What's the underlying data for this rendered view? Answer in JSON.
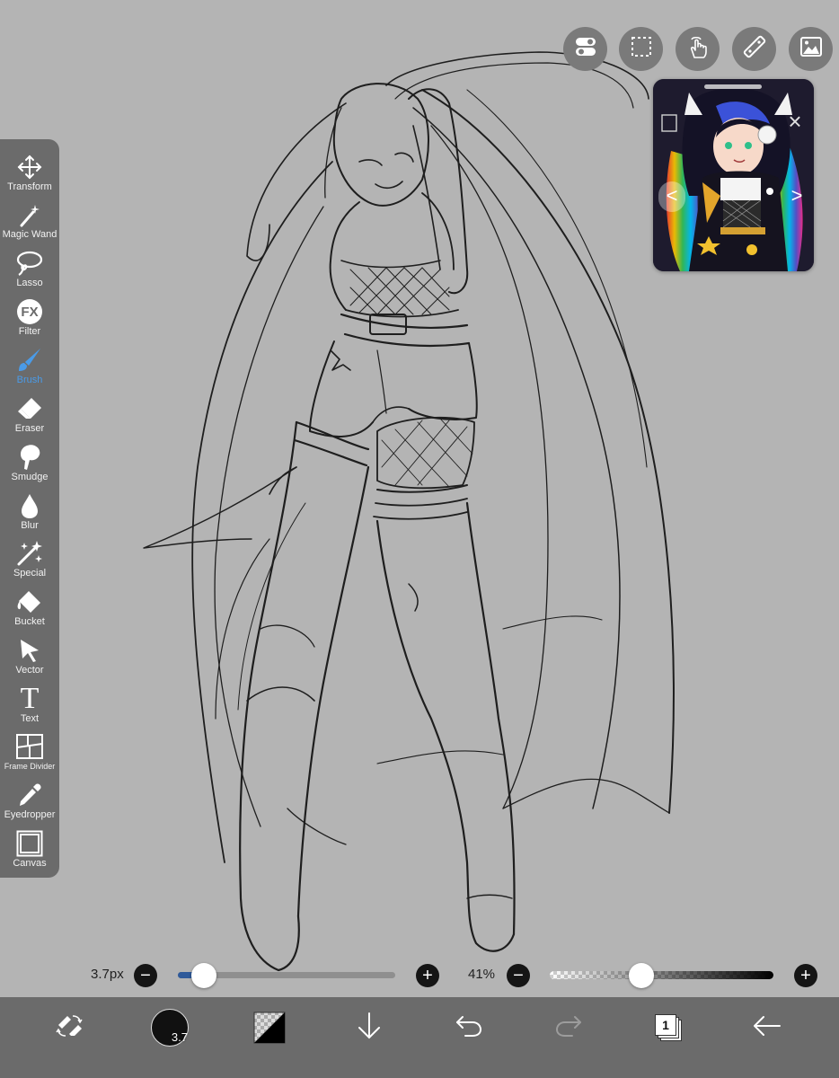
{
  "tools": [
    {
      "label": "Transform",
      "icon": "transform-icon",
      "active": false
    },
    {
      "label": "Magic Wand",
      "icon": "magic-wand-icon",
      "active": false
    },
    {
      "label": "Lasso",
      "icon": "lasso-icon",
      "active": false
    },
    {
      "label": "Filter",
      "icon": "fx-icon",
      "active": false
    },
    {
      "label": "Brush",
      "icon": "brush-icon",
      "active": true
    },
    {
      "label": "Eraser",
      "icon": "eraser-icon",
      "active": false
    },
    {
      "label": "Smudge",
      "icon": "smudge-icon",
      "active": false
    },
    {
      "label": "Blur",
      "icon": "droplet-icon",
      "active": false
    },
    {
      "label": "Special",
      "icon": "sparkle-icon",
      "active": false
    },
    {
      "label": "Bucket",
      "icon": "bucket-icon",
      "active": false
    },
    {
      "label": "Vector",
      "icon": "vector-arrow-icon",
      "active": false
    },
    {
      "label": "Text",
      "icon": "text-icon",
      "active": false
    },
    {
      "label": "Frame Divider",
      "icon": "frame-divider-icon",
      "active": false
    },
    {
      "label": "Eyedropper",
      "icon": "eyedropper-icon",
      "active": false
    },
    {
      "label": "Canvas",
      "icon": "canvas-icon",
      "active": false
    }
  ],
  "filter_icon_text": "FX",
  "text_icon_glyph": "T",
  "top_buttons": [
    "toggle-icon",
    "selection-icon",
    "touch-icon",
    "ruler-icon",
    "image-icon"
  ],
  "reference_window": {
    "nav_prev": "<",
    "nav_next": ">",
    "close": "×"
  },
  "brush_size": {
    "label": "3.7px",
    "minus": "−",
    "plus": "+",
    "level": 0.12
  },
  "opacity": {
    "label": "41%",
    "minus": "−",
    "plus": "+",
    "level": 0.41
  },
  "bottom_bar": {
    "brush_badge": "3.7",
    "layer_count": "1",
    "items": [
      "quick-tools-icon",
      "brush-size-icon",
      "color-swatch",
      "download-icon",
      "undo-icon",
      "redo-icon",
      "layers-icon",
      "back-arrow-icon"
    ]
  },
  "colors": {
    "canvas": "#b4b4b4",
    "panel": "#6b6b6b",
    "active_tool": "#4a9be8",
    "size_slider_fill": "#2f5a9a"
  }
}
